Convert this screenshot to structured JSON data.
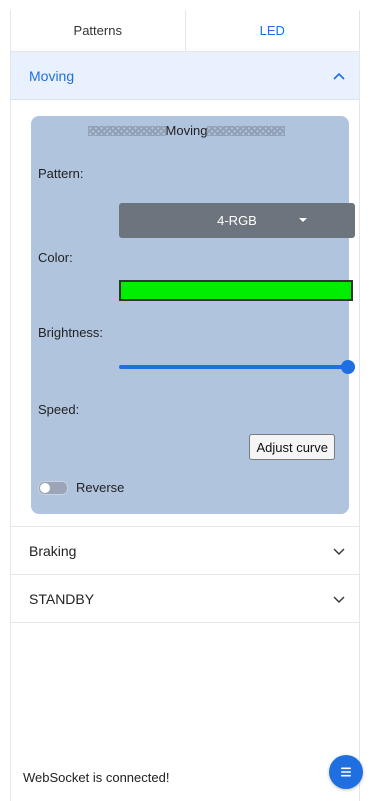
{
  "tabs": [
    {
      "label": "Patterns",
      "active": false
    },
    {
      "label": "LED",
      "active": true
    }
  ],
  "sections": {
    "moving": {
      "label": "Moving",
      "expanded": true
    },
    "braking": {
      "label": "Braking",
      "expanded": false
    },
    "standby": {
      "label": "STANDBY",
      "expanded": false
    }
  },
  "card": {
    "title": "Moving",
    "pattern_label": "Pattern:",
    "pattern_value": "4-RGB",
    "color_label": "Color:",
    "color_value": "#00ee00",
    "brightness_label": "Brightness:",
    "brightness_level": 1.0,
    "speed_label": "Speed:",
    "adjust_curve_label": "Adjust curve",
    "reverse_label": "Reverse",
    "reverse_on": false
  },
  "status": {
    "text": "WebSocket is connected!"
  },
  "icons": {
    "expand": "chevron-up-icon",
    "collapse": "chevron-down-icon",
    "menu": "menu-icon"
  },
  "colors": {
    "accent": "#1f6fe0",
    "card_bg": "#b0c4de",
    "select_bg": "#6c757d"
  }
}
